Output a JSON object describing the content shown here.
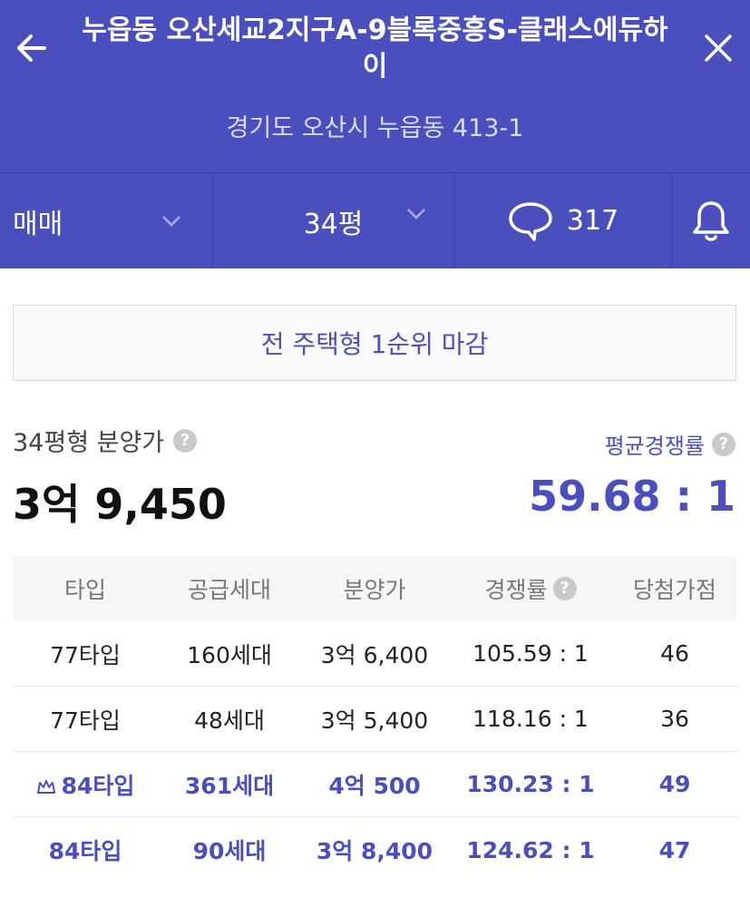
{
  "header": {
    "title": "누읍동 오산세교2지구A-9블록중흥S-클래스에듀하이",
    "address": "경기도 오산시 누읍동 413-1",
    "back_icon": "arrow-left-icon",
    "close_icon": "close-icon"
  },
  "filters": {
    "trade_type": "매매",
    "size": "34평",
    "comment_count": "317",
    "icons": [
      "chevron-down-icon",
      "chat-bubble-icon",
      "bell-icon"
    ]
  },
  "banner": {
    "text": "전 주택형 1순위 마감"
  },
  "price": {
    "label": "34평형 분양가",
    "value": "3억 9,450",
    "help_icon": "?"
  },
  "competition": {
    "label": "평균경쟁률",
    "value": "59.68 : 1",
    "help_icon": "?"
  },
  "table": {
    "headers": [
      "타입",
      "공급세대",
      "분양가",
      "경쟁률",
      "당첨가점"
    ],
    "header_help_icon": "?",
    "rows": [
      {
        "type": "77타입",
        "units": "160세대",
        "price": "3억 6,400",
        "ratio": "105.59 : 1",
        "score": "46",
        "highlight": false,
        "crown": false
      },
      {
        "type": "77타입",
        "units": "48세대",
        "price": "3억 5,400",
        "ratio": "118.16 : 1",
        "score": "36",
        "highlight": false,
        "crown": false
      },
      {
        "type": "84타입",
        "units": "361세대",
        "price": "4억 500",
        "ratio": "130.23 : 1",
        "score": "49",
        "highlight": true,
        "crown": true
      },
      {
        "type": "84타입",
        "units": "90세대",
        "price": "3억 8,400",
        "ratio": "124.62 : 1",
        "score": "47",
        "highlight": true,
        "crown": false
      }
    ]
  },
  "colors": {
    "primary": "#4b4fbd",
    "header_bg": "#4b4fbd",
    "help_icon_bg": "#c9c9c9"
  }
}
